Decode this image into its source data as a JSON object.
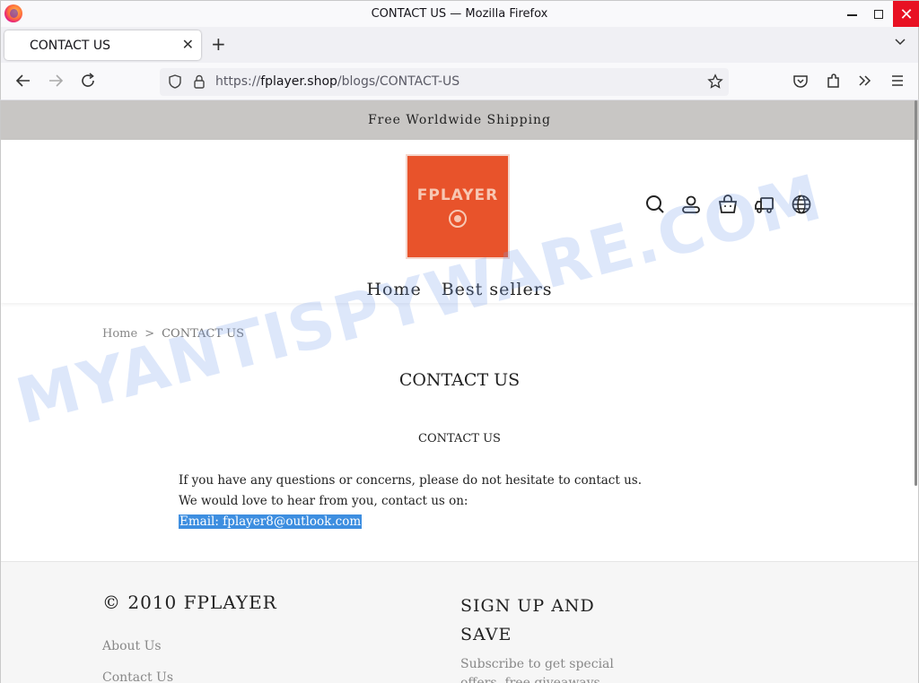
{
  "window": {
    "title": "CONTACT US — Mozilla Firefox"
  },
  "tab": {
    "label": "CONTACT US"
  },
  "urlbar": {
    "scheme": "https://",
    "host": "fplayer.shop",
    "path": "/blogs/CONTACT-US"
  },
  "site": {
    "announcement": "Free Worldwide Shipping",
    "logo_text": "FPLAYER",
    "menu": [
      {
        "label": "Home"
      },
      {
        "label": "Best sellers"
      }
    ],
    "breadcrumb": {
      "home": "Home",
      "separator": ">",
      "current": "CONTACT US"
    },
    "page_title": "CONTACT US",
    "article": {
      "heading": "CONTACT US",
      "line1": "If you have any questions or concerns, please do not hesitate to contact us.",
      "line2": "We would love to hear from you, contact us on:",
      "email": "Email: fplayer8@outlook.com"
    },
    "footer": {
      "brand": "© 2010 FPLAYER",
      "links": [
        {
          "label": "About Us"
        },
        {
          "label": "Contact Us"
        }
      ],
      "signup_title": "SIGN UP AND SAVE",
      "signup_text": "Subscribe to get special offers, free giveaways, and"
    }
  },
  "watermark": "MYANTISPYWARE.COM",
  "colors": {
    "accent": "#e8532b",
    "selection": "#3d8ee0",
    "announce_bg": "#c8c6c4",
    "close_red": "#e81123"
  }
}
